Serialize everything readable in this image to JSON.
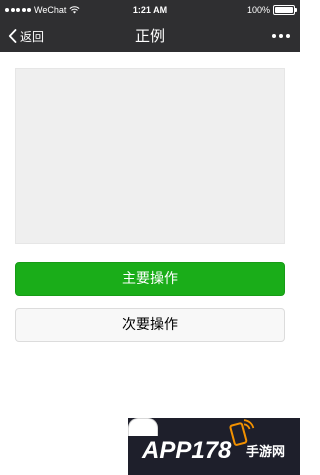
{
  "status_bar": {
    "carrier": "WeChat",
    "time": "1:21 AM",
    "battery": "100%",
    "icons": [
      "signal-dots-icon",
      "wifi-icon",
      "battery-icon"
    ]
  },
  "nav": {
    "back_label": "返回",
    "title": "正例",
    "icons": [
      "chevron-left-icon",
      "more-dots-icon"
    ]
  },
  "main": {
    "primary_button_label": "主要操作",
    "secondary_button_label": "次要操作"
  },
  "watermark": {
    "text": "APP178手游网"
  },
  "colors": {
    "bar_background": "#2f2f31",
    "primary": "#1aad19",
    "secondary_background": "#f8f8f8",
    "placeholder": "#efefef"
  }
}
